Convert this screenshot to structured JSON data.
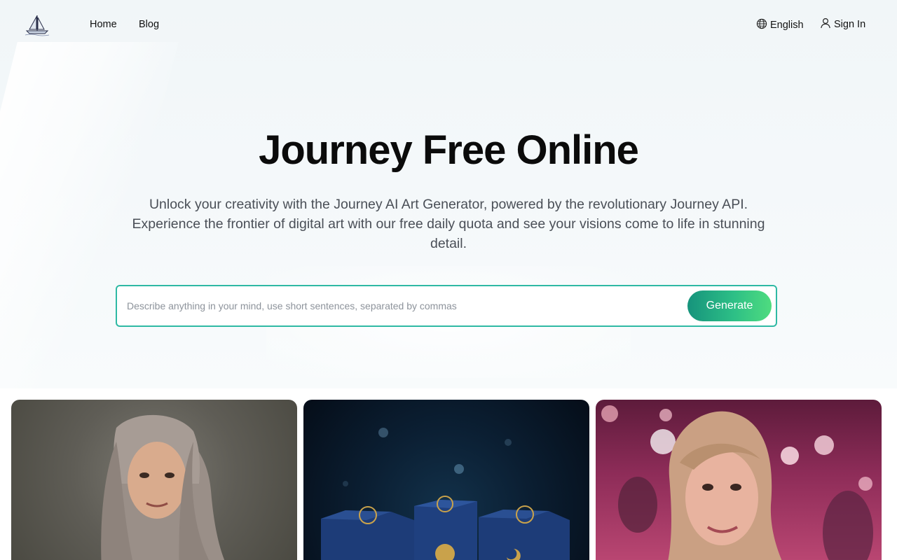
{
  "header": {
    "logo_icon": "sailboat-icon",
    "nav": [
      {
        "label": "Home"
      },
      {
        "label": "Blog"
      }
    ],
    "language": {
      "label": "English",
      "icon": "globe-icon"
    },
    "sign_in": {
      "label": "Sign In",
      "icon": "user-icon"
    }
  },
  "hero": {
    "title": "Journey Free Online",
    "subtitle": "Unlock your creativity with the Journey AI Art Generator, powered by the revolutionary Journey API. Experience the frontier of digital art with our free daily quota and see your visions come to life in stunning detail.",
    "prompt": {
      "value": "",
      "placeholder": "Describe anything in your mind, use short sentences, separated by commas"
    },
    "generate_label": "Generate"
  },
  "colors": {
    "accent_border": "#2fb9a4",
    "button_start": "#16937c",
    "button_end": "#4fdc7f"
  }
}
